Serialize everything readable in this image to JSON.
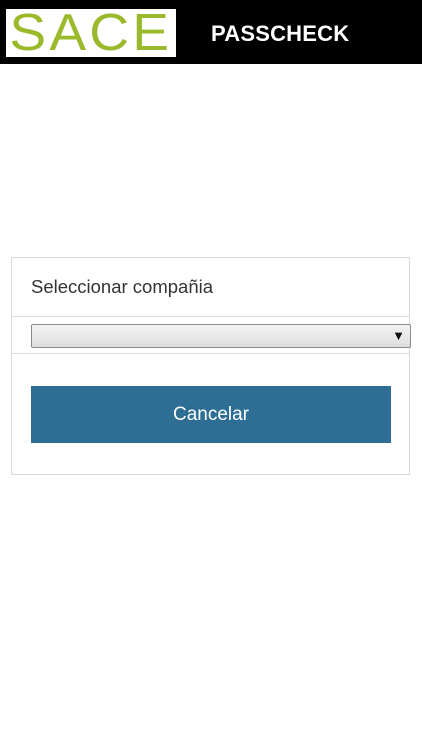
{
  "header": {
    "logo_text": "SACE",
    "title": "PASSCHECK",
    "logo_color": "#9aba2b",
    "background": "#000000"
  },
  "panel": {
    "heading": "Seleccionar compañia",
    "select": {
      "selected_value": "",
      "arrow_glyph": "▼"
    },
    "cancel_label": "Cancelar",
    "button_color": "#2e6e95"
  }
}
